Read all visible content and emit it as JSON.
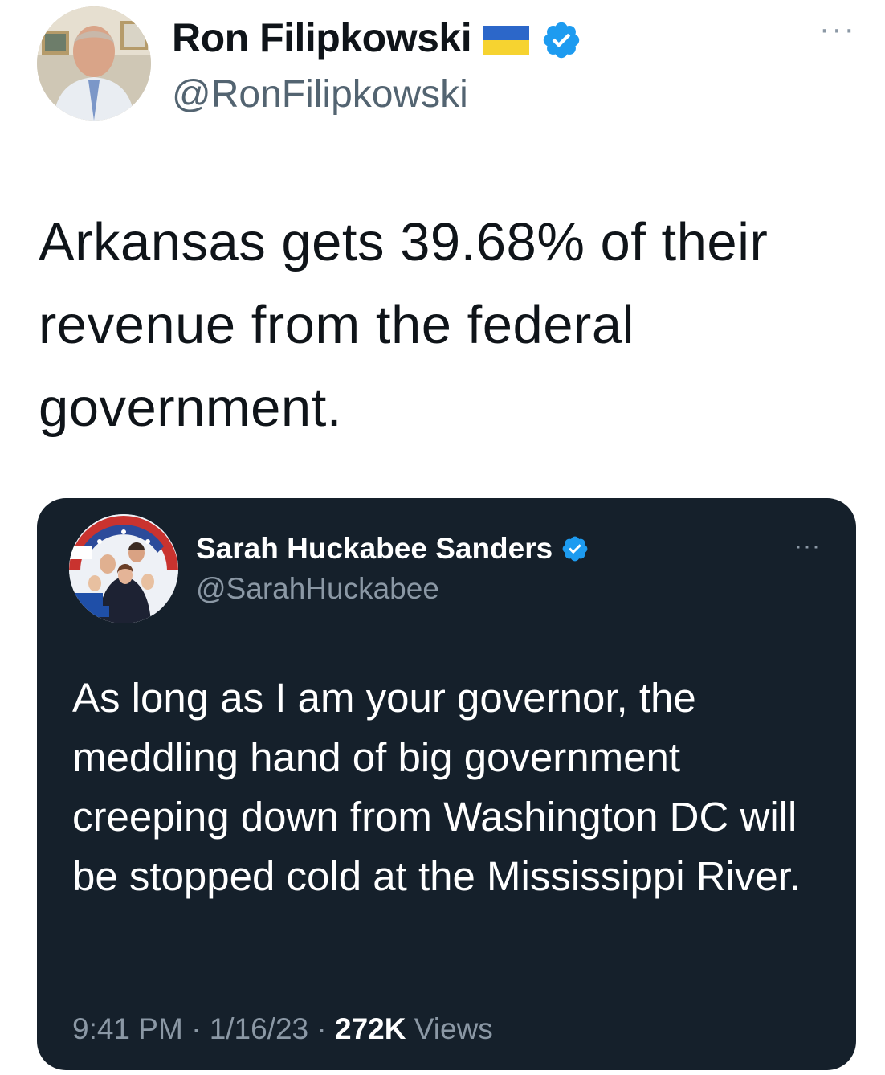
{
  "tweet": {
    "author": {
      "display_name": "Ron Filipkowski",
      "handle": "@RonFilipkowski",
      "avatar_icon": "user-avatar-photo",
      "badges": [
        "ukraine-flag-icon",
        "verified-badge-icon"
      ]
    },
    "more_label": "···",
    "text": "Arkansas gets 39.68% of their revenue from the federal government."
  },
  "quoted_tweet": {
    "author": {
      "display_name": "Sarah Huckabee Sanders",
      "handle": "@SarahHuckabee",
      "avatar_icon": "family-photo-avatar",
      "badges": [
        "verified-badge-icon"
      ]
    },
    "more_label": "···",
    "text": "As long as I am your governor, the meddling hand of big government creeping down from Washington DC will be stopped cold at the Mississippi River.",
    "time": "9:41 PM",
    "separator": " · ",
    "date": "1/16/23",
    "views_count": "272K",
    "views_label": "Views"
  },
  "colors": {
    "verified_blue": "#1d9bf0",
    "quote_background": "#15202b",
    "secondary_text": "#536471",
    "quote_secondary_text": "#8b98a5",
    "flag_blue": "#0057b7",
    "flag_yellow": "#ffd700"
  }
}
